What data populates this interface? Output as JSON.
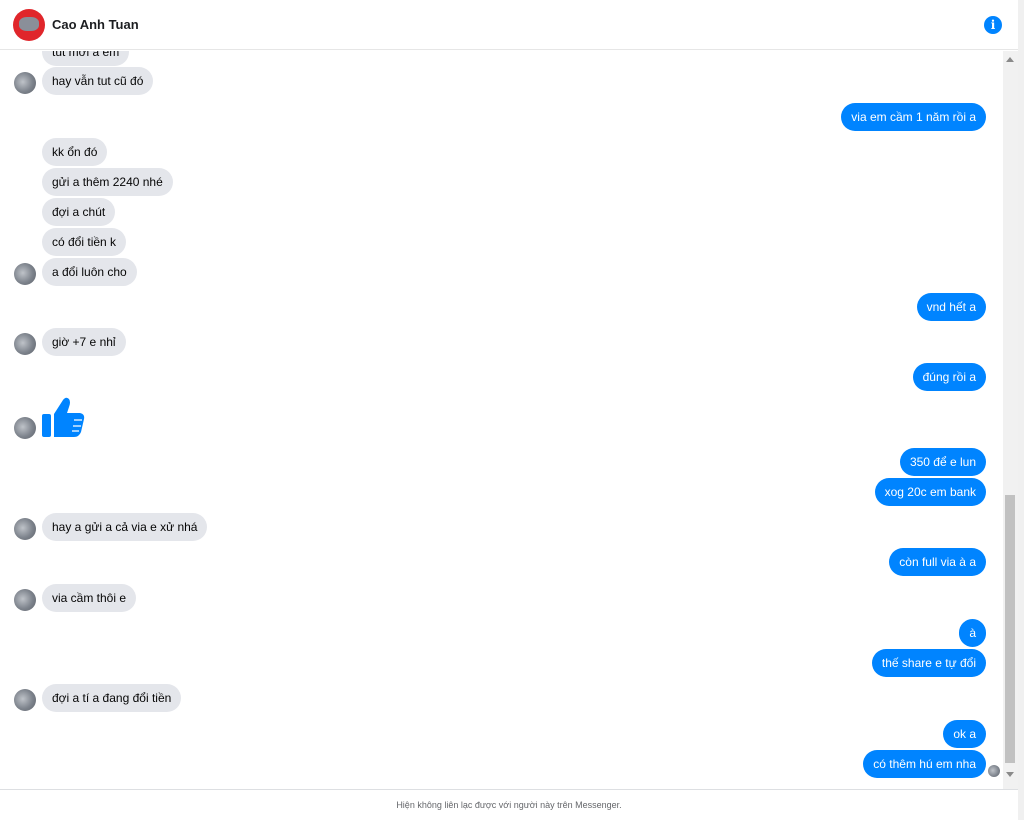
{
  "header": {
    "name": "Cao Anh Tuan",
    "info_icon": "info-icon",
    "info_glyph": "i"
  },
  "messages": [
    {
      "from": "them",
      "text": "tut mới a em"
    },
    {
      "from": "them",
      "text": "hay vẫn tut cũ đó"
    },
    {
      "from": "me",
      "text": "via em cầm 1 năm rồi a"
    },
    {
      "from": "them",
      "text": "kk ổn đó"
    },
    {
      "from": "them",
      "text": "gửi a thêm 2240 nhé"
    },
    {
      "from": "them",
      "text": "đợi a chút"
    },
    {
      "from": "them",
      "text": "có đổi tiền k"
    },
    {
      "from": "them",
      "text": "a đổi luôn cho"
    },
    {
      "from": "me",
      "text": "vnd hết a"
    },
    {
      "from": "them",
      "text": "giờ +7 e nhỉ"
    },
    {
      "from": "me",
      "text": "đúng rồi a"
    },
    {
      "from": "them",
      "sticker": "thumbs-up-icon"
    },
    {
      "from": "me",
      "text": "350 để e lun"
    },
    {
      "from": "me",
      "text": "xog 20c em bank"
    },
    {
      "from": "them",
      "text": "hay a gửi a cả via e xử nhá"
    },
    {
      "from": "me",
      "text": "còn full via à a"
    },
    {
      "from": "them",
      "text": "via cầm thôi e"
    },
    {
      "from": "me",
      "text": "à"
    },
    {
      "from": "me",
      "text": "thế share e tự đổi"
    },
    {
      "from": "them",
      "text": "đợi a tí a đang đổi tiền"
    },
    {
      "from": "me",
      "text": "ok a"
    },
    {
      "from": "me",
      "text": "có thêm hú em nha"
    }
  ],
  "footer": {
    "notice": "Hiện không liên lạc được với người này trên Messenger."
  },
  "colors": {
    "outgoing_bubble": "#0084ff",
    "incoming_bubble": "#e4e6eb",
    "avatar_ring": "#e0262b"
  }
}
